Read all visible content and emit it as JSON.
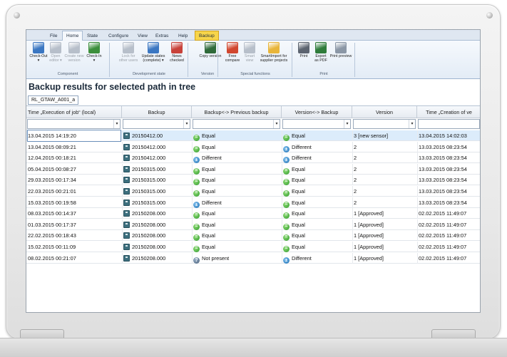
{
  "ribbon_tabs": [
    "File",
    "Home",
    "State",
    "Configure",
    "View",
    "Extras",
    "Help",
    "Backup"
  ],
  "ribbon_groups": [
    {
      "label": "Component",
      "buttons": [
        {
          "label": "Check-Out",
          "sub": "▾",
          "icon": "checkout-icon",
          "color": "#3b77c2",
          "disabled": false
        },
        {
          "label": "Open",
          "sub": "editor ▾",
          "icon": "open-editor-icon",
          "color": "#b7bfca",
          "disabled": true
        },
        {
          "label": "Create new",
          "sub": "version",
          "icon": "create-version-icon",
          "color": "#b7bfca",
          "disabled": true
        },
        {
          "label": "Check-In",
          "sub": "▾",
          "icon": "checkin-icon",
          "color": "#3c8f3c",
          "disabled": false
        }
      ]
    },
    {
      "label": "Development state",
      "buttons": [
        {
          "label": "Lock for",
          "sub": "other users",
          "icon": "lock-icon",
          "color": "#b7bfca",
          "disabled": true
        },
        {
          "label": "Update states",
          "sub": "(complete) ▾",
          "icon": "update-states-icon",
          "color": "#3b77c2",
          "disabled": false
        },
        {
          "label": "News",
          "sub": "checked",
          "icon": "news-checked-icon",
          "color": "#c8423a",
          "disabled": false
        }
      ]
    },
    {
      "label": "Version",
      "buttons": [
        {
          "label": "Copy version",
          "sub": "",
          "icon": "copy-version-icon",
          "color": "#2f6a3a",
          "disabled": false
        }
      ]
    },
    {
      "label": "Special functions",
      "buttons": [
        {
          "label": "Free",
          "sub": "compare",
          "icon": "free-compare-icon",
          "color": "#d1472f",
          "disabled": false
        },
        {
          "label": "Smart",
          "sub": "view",
          "icon": "smart-view-icon",
          "color": "#b7bfca",
          "disabled": true
        },
        {
          "label": "SmartImport for",
          "sub": "supplier projects",
          "icon": "smartimport-icon",
          "color": "#e8b53a",
          "disabled": false
        }
      ]
    },
    {
      "label": "Print",
      "buttons": [
        {
          "label": "Print",
          "sub": "",
          "icon": "print-icon",
          "color": "#5c6470",
          "disabled": false
        },
        {
          "label": "Export",
          "sub": "as PDF",
          "icon": "export-pdf-icon",
          "color": "#2f7c3b",
          "disabled": false
        },
        {
          "label": "Print preview",
          "sub": "",
          "icon": "print-preview-icon",
          "color": "#8b97a6",
          "disabled": false
        }
      ]
    }
  ],
  "pane_title": "Backup results for selected path in tree",
  "path_tab": "RL_GTAW_A001_a",
  "columns": [
    "Time „Execution of job“ (local)",
    "Backup",
    "Backup<-> Previous backup",
    "Version<-> Backup",
    "Version",
    "Time „Creation of ve"
  ],
  "rows": [
    {
      "time": "13.04.2015 14:19:20",
      "backup": "20150412.00",
      "prev": "Equal",
      "prev_state": "eq",
      "vb": "Equal",
      "vb_state": "eq",
      "version": "3 [new sensor]",
      "created": "13.04.2015 14:02:03"
    },
    {
      "time": "13.04.2015 08:09:21",
      "backup": "20150412.000",
      "prev": "Equal",
      "prev_state": "eq",
      "vb": "Different",
      "vb_state": "diff",
      "version": "2",
      "created": "13.03.2015 08:23:54"
    },
    {
      "time": "12.04.2015 00:18:21",
      "backup": "20150412.000",
      "prev": "Different",
      "prev_state": "diff",
      "vb": "Different",
      "vb_state": "diff",
      "version": "2",
      "created": "13.03.2015 08:23:54"
    },
    {
      "time": "05.04.2015 00:08:27",
      "backup": "20150315.000",
      "prev": "Equal",
      "prev_state": "eq",
      "vb": "Equal",
      "vb_state": "eq",
      "version": "2",
      "created": "13.03.2015 08:23:54"
    },
    {
      "time": "29.03.2015 00:17:34",
      "backup": "20150315.000",
      "prev": "Equal",
      "prev_state": "eq",
      "vb": "Equal",
      "vb_state": "eq",
      "version": "2",
      "created": "13.03.2015 08:23:54"
    },
    {
      "time": "22.03.2015 00:21:01",
      "backup": "20150315.000",
      "prev": "Equal",
      "prev_state": "eq",
      "vb": "Equal",
      "vb_state": "eq",
      "version": "2",
      "created": "13.03.2015 08:23:54"
    },
    {
      "time": "15.03.2015 00:19:58",
      "backup": "20150315.000",
      "prev": "Different",
      "prev_state": "diff",
      "vb": "Equal",
      "vb_state": "eq",
      "version": "2",
      "created": "13.03.2015 08:23:54"
    },
    {
      "time": "08.03.2015 00:14:37",
      "backup": "20150208.000",
      "prev": "Equal",
      "prev_state": "eq",
      "vb": "Equal",
      "vb_state": "eq",
      "version": "1 [Approved]",
      "created": "02.02.2015 11:49:07"
    },
    {
      "time": "01.03.2015 00:17:37",
      "backup": "20150208.000",
      "prev": "Equal",
      "prev_state": "eq",
      "vb": "Equal",
      "vb_state": "eq",
      "version": "1 [Approved]",
      "created": "02.02.2015 11:49:07"
    },
    {
      "time": "22.02.2015 00:18:43",
      "backup": "20150208.000",
      "prev": "Equal",
      "prev_state": "eq",
      "vb": "Equal",
      "vb_state": "eq",
      "version": "1 [Approved]",
      "created": "02.02.2015 11:49:07"
    },
    {
      "time": "15.02.2015 00:11:09",
      "backup": "20150208.000",
      "prev": "Equal",
      "prev_state": "eq",
      "vb": "Equal",
      "vb_state": "eq",
      "version": "1 [Approved]",
      "created": "02.02.2015 11:49:07"
    },
    {
      "time": "08.02.2015 00:21:07",
      "backup": "20150208.000",
      "prev": "Not present",
      "prev_state": "np",
      "vb": "Different",
      "vb_state": "diff",
      "version": "1 [Approved]",
      "created": "02.02.2015 11:49:07"
    }
  ],
  "filter_arrow": "▾",
  "colors": {
    "accent_tab": "#f7d54a",
    "selected_row": "#dcecfb",
    "ribbon": "#e3ecf6"
  }
}
